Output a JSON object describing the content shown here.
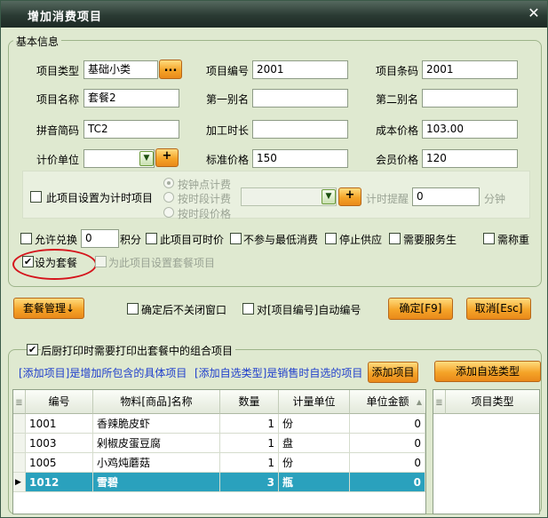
{
  "window": {
    "title": "增加消费项目",
    "close_glyph": "✕"
  },
  "basic_info": {
    "legend": "基本信息",
    "item_type_label": "项目类型",
    "item_type_value": "基础小类",
    "item_type_browse": "...",
    "item_code_label": "项目编号",
    "item_code_value": "2001",
    "barcode_label": "项目条码",
    "barcode_value": "2001",
    "item_name_label": "项目名称",
    "item_name_value": "套餐2",
    "alias1_label": "第一别名",
    "alias1_value": "",
    "alias2_label": "第二别名",
    "alias2_value": "",
    "pinyin_label": "拼音简码",
    "pinyin_value": "TC2",
    "process_time_label": "加工时长",
    "process_time_value": "",
    "cost_price_label": "成本价格",
    "cost_price_value": "103.00",
    "pricing_unit_label": "计价单位",
    "pricing_unit_value": "",
    "standard_price_label": "标准价格",
    "standard_price_value": "150",
    "member_price_label": "会员价格",
    "member_price_value": "120",
    "add_plus": "+"
  },
  "timed": {
    "timed_item_label": "此项目设置为计时项目",
    "radio_by_clock": "按钟点计费",
    "radio_by_period": "按时段计费",
    "radio_by_period_price": "按时段价格",
    "timer_reminder_label": "计时提醒",
    "timer_reminder_value": "0",
    "minutes_unit": "分钟"
  },
  "options": {
    "allow_exchange": "允许兑换",
    "exchange_points_value": "0",
    "points_unit": "积分",
    "time_priced": "此项目可时价",
    "exclude_min_consumption": "不参与最低消费",
    "stop_supply": "停止供应",
    "need_service": "需要服务生",
    "need_weighing": "需称重",
    "set_as_package": "设为套餐",
    "set_package_items": "为此项目设置套餐项目",
    "set_as_package_checked": "✔",
    "check_mark": "✔"
  },
  "actions": {
    "package_manage": "套餐管理↓",
    "keep_window_open": "确定后不关闭窗口",
    "auto_numbering": "对[项目编号]自动编号",
    "confirm": "确定[F9]",
    "cancel": "取消[Esc]"
  },
  "package_section": {
    "print_combo_label": "后厨打印时需要打印出套餐中的组合项目",
    "note_add_item": "[添加项目]是增加所包含的具体项目",
    "note_add_optional": "[添加自选类型]是销售时自选的项目",
    "add_item_button": "添加项目",
    "add_optional_type_button": "添加自选类型",
    "columns": [
      "编号",
      "物料[商品]名称",
      "数量",
      "计量单位",
      "单位金额"
    ],
    "sort_glyph": "▲",
    "row_indicator": "≣",
    "rows": [
      {
        "code": "1001",
        "name": "香辣脆皮虾",
        "qty": "1",
        "unit": "份",
        "amount": "0"
      },
      {
        "code": "1003",
        "name": "剁椒皮蛋豆腐",
        "qty": "1",
        "unit": "盘",
        "amount": "0"
      },
      {
        "code": "1005",
        "name": "小鸡炖蘑菇",
        "qty": "1",
        "unit": "份",
        "amount": "0"
      },
      {
        "code": "1012",
        "name": "雪碧",
        "qty": "3",
        "unit": "瓶",
        "amount": "0"
      }
    ],
    "selected_marker": "▶",
    "side_grid_column": "项目类型"
  }
}
